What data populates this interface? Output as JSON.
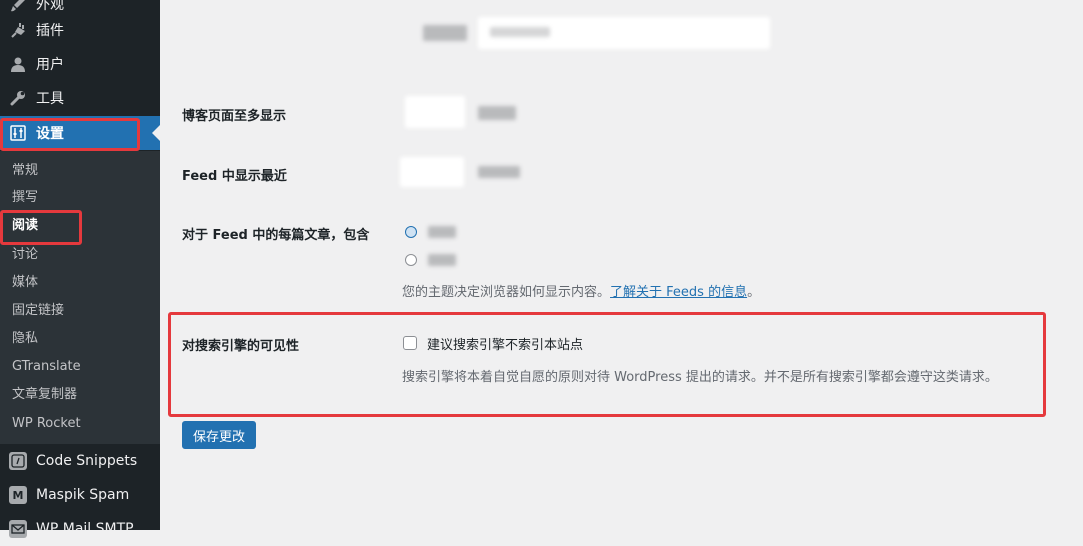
{
  "sidebar": {
    "menu": [
      {
        "label": "外观",
        "icon": "paintbrush-icon"
      },
      {
        "label": "插件",
        "icon": "plugin-icon"
      },
      {
        "label": "用户",
        "icon": "user-icon"
      },
      {
        "label": "工具",
        "icon": "wrench-icon"
      },
      {
        "label": "设置",
        "icon": "settings-icon"
      }
    ],
    "submenu": [
      "常规",
      "撰写",
      "阅读",
      "讨论",
      "媒体",
      "固定链接",
      "隐私",
      "GTranslate",
      "文章复制器",
      "WP Rocket"
    ],
    "active_submenu": "阅读",
    "plugins": [
      {
        "label": "Code Snippets",
        "icon": "code-snippets-icon"
      },
      {
        "label": "Maspik Spam",
        "icon": "maspik-icon",
        "badge": "M"
      },
      {
        "label": "WP Mail SMTP",
        "icon": "mail-smtp-icon"
      }
    ]
  },
  "main": {
    "blog_pages_label": "博客页面至多显示",
    "feed_recent_label": "Feed 中显示最近",
    "feed_include_label": "对于 Feed 中的每篇文章，包含",
    "feed_desc_prefix": "您的主题决定浏览器如何显示内容。",
    "feed_desc_link": "了解关于 Feeds 的信息",
    "feed_desc_suffix": "。",
    "search_visibility_label": "对搜索引擎的可见性",
    "search_checkbox_label": "建议搜索引擎不索引本站点",
    "search_checkbox_checked": false,
    "search_desc": "搜索引擎将本着自觉自愿的原则对待 WordPress 提出的请求。并不是所有搜索引擎都会遵守这类请求。",
    "save_button": "保存更改"
  },
  "colors": {
    "sidebar_bg": "#1d2327",
    "submenu_bg": "#2c3338",
    "accent": "#2271b1",
    "highlight_box": "#e5393d",
    "page_bg": "#f0f0f1"
  }
}
